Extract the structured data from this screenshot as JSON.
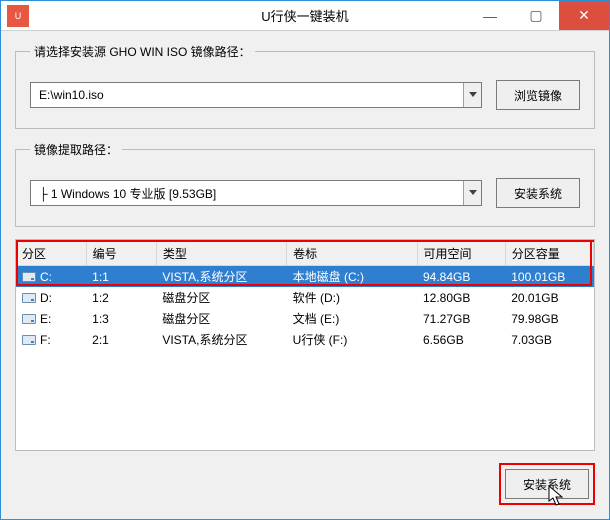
{
  "window": {
    "title": "U行侠一键装机",
    "app_icon_text": "U"
  },
  "win_controls": {
    "minimize": "—",
    "maximize": "▢",
    "close": "✕"
  },
  "source": {
    "legend": "请选择安装源 GHO WIN ISO 镜像路径：",
    "value": "E:\\win10.iso",
    "browse_label": "浏览镜像"
  },
  "extract": {
    "legend": "镜像提取路径：",
    "value": "├ 1 Windows 10 专业版 [9.53GB]",
    "install_label": "安装系统"
  },
  "table": {
    "headers": [
      "分区",
      "编号",
      "类型",
      "卷标",
      "可用空间",
      "分区容量"
    ],
    "col_widths": [
      "70px",
      "70px",
      "130px",
      "130px",
      "88px",
      "88px"
    ],
    "rows": [
      {
        "drive": "C:",
        "index": "1:1",
        "type": "VISTA,系统分区",
        "label": "本地磁盘 (C:)",
        "free": "94.84GB",
        "cap": "100.01GB",
        "selected": true
      },
      {
        "drive": "D:",
        "index": "1:2",
        "type": "磁盘分区",
        "label": "软件 (D:)",
        "free": "12.80GB",
        "cap": "20.01GB",
        "selected": false
      },
      {
        "drive": "E:",
        "index": "1:3",
        "type": "磁盘分区",
        "label": "文档 (E:)",
        "free": "71.27GB",
        "cap": "79.98GB",
        "selected": false
      },
      {
        "drive": "F:",
        "index": "2:1",
        "type": "VISTA,系统分区",
        "label": "U行侠 (F:)",
        "free": "6.56GB",
        "cap": "7.03GB",
        "selected": false
      }
    ]
  },
  "footer": {
    "install_label": "安装系统"
  }
}
